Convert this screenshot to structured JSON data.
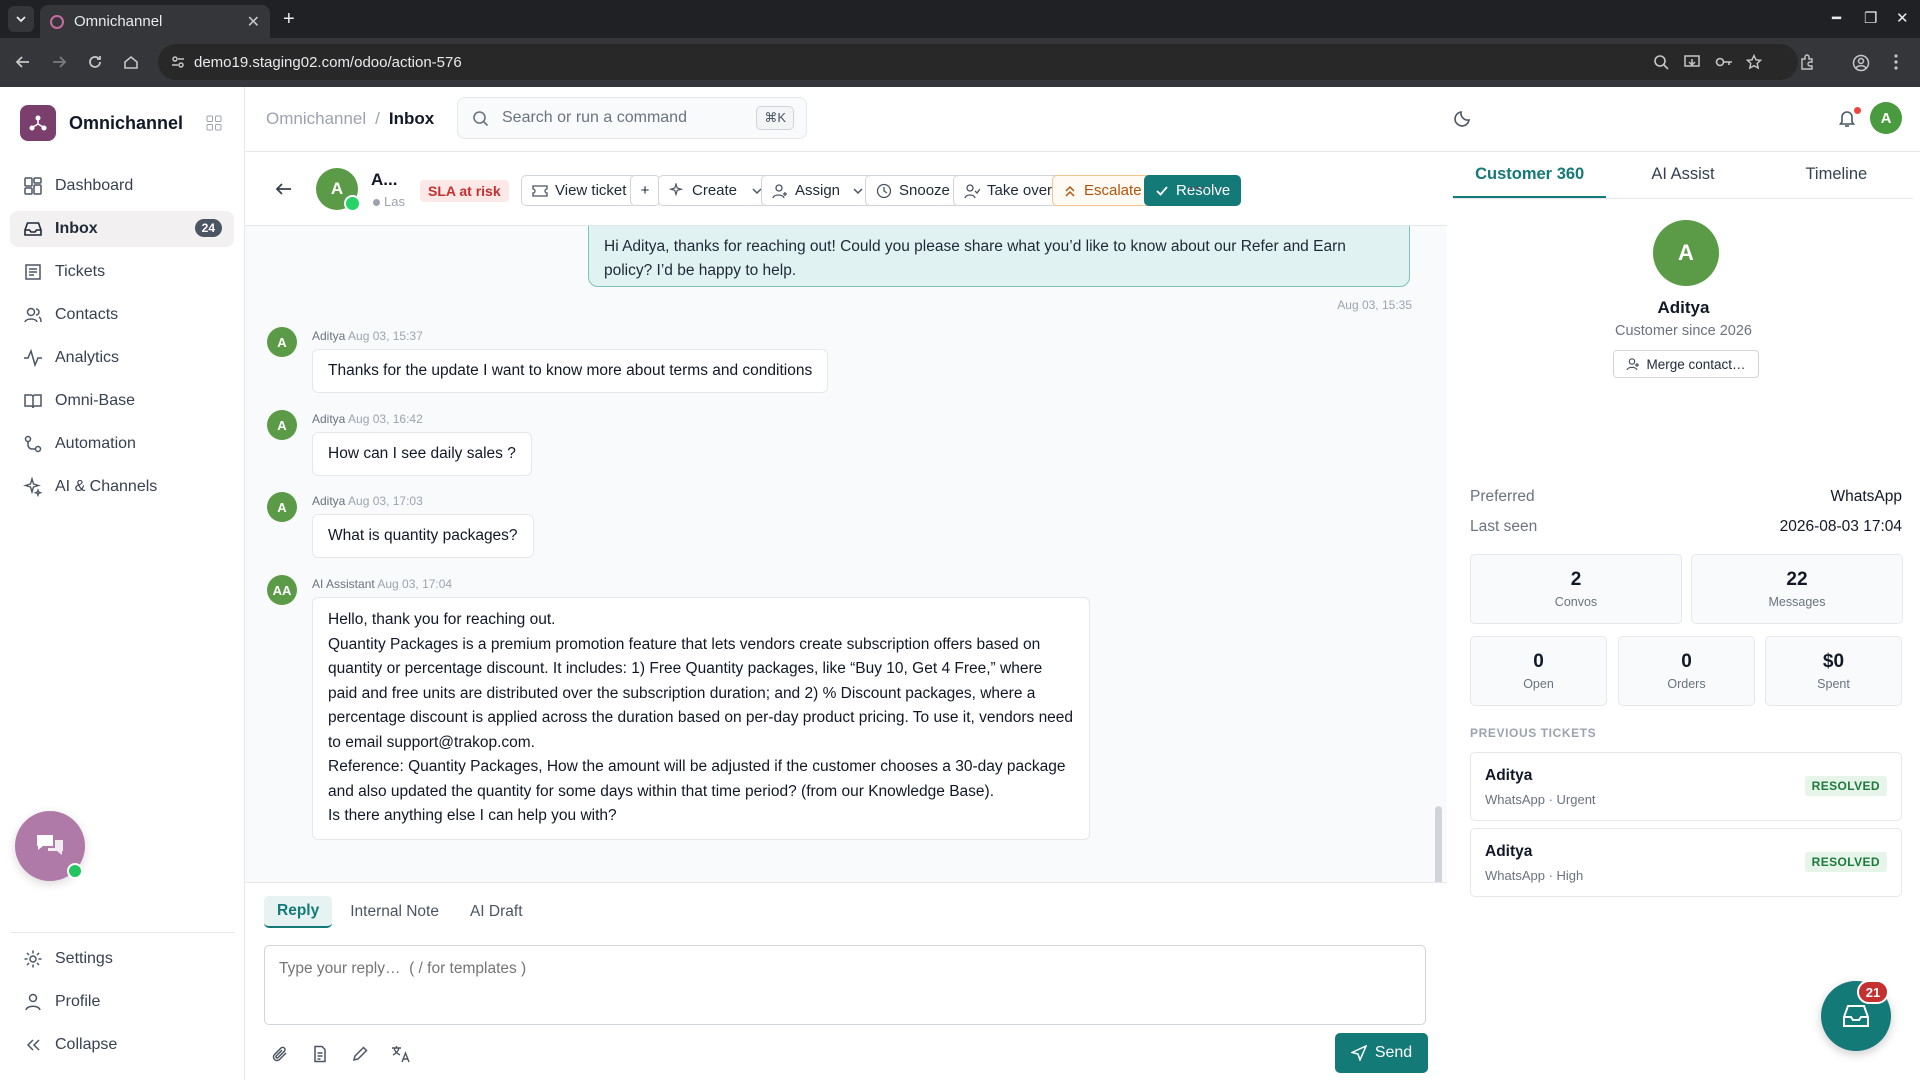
{
  "browser": {
    "tab_title": "Omnichannel",
    "url": "demo19.staging02.com/odoo/action-576"
  },
  "sidebar": {
    "brand": "Omnichannel",
    "items": [
      {
        "label": "Dashboard",
        "icon": "dashboard-icon"
      },
      {
        "label": "Inbox",
        "icon": "inbox-icon",
        "badge": "24",
        "active": true
      },
      {
        "label": "Tickets",
        "icon": "ticket-icon"
      },
      {
        "label": "Contacts",
        "icon": "contacts-icon"
      },
      {
        "label": "Analytics",
        "icon": "analytics-icon"
      },
      {
        "label": "Omni-Base",
        "icon": "book-icon"
      },
      {
        "label": "Automation",
        "icon": "automation-icon"
      },
      {
        "label": "AI & Channels",
        "icon": "sparkle-icon"
      }
    ],
    "bottom": [
      {
        "label": "Settings",
        "icon": "gear-icon"
      },
      {
        "label": "Profile",
        "icon": "user-icon"
      },
      {
        "label": "Collapse",
        "icon": "collapse-icon"
      }
    ]
  },
  "header": {
    "breadcrumb_root": "Omnichannel",
    "breadcrumb_current": "Inbox",
    "search_placeholder": "Search or run a command",
    "search_shortcut": "⌘K",
    "user_initial": "A"
  },
  "conversation": {
    "contact_initial": "A",
    "contact_name": "A...",
    "contact_sub": "Las",
    "sla_label": "SLA at risk",
    "buttons": {
      "view_ticket": "View ticket",
      "create": "Create",
      "assign": "Assign",
      "snooze": "Snooze",
      "take_over": "Take over",
      "escalate": "Escalate",
      "resolve": "Resolve"
    },
    "outgoing": {
      "text": "Hi Aditya, thanks for reaching out! Could you please share what you’d like to know about our Refer and Earn policy? I’d be happy to help.",
      "time": "Aug 03, 15:35"
    },
    "messages": [
      {
        "initials": "A",
        "author": "Aditya",
        "time": "Aug 03, 15:37",
        "text": "Thanks for the update I want to know more about terms and conditions"
      },
      {
        "initials": "A",
        "author": "Aditya",
        "time": "Aug 03, 16:42",
        "text": "How can I see daily sales ?"
      },
      {
        "initials": "A",
        "author": "Aditya",
        "time": "Aug 03, 17:03",
        "text": "What is quantity packages?"
      }
    ],
    "ai_message": {
      "initials": "AA",
      "author": "AI Assistant",
      "time": "Aug 03, 17:04",
      "line1": "Hello, thank you for reaching out.",
      "line2": "Quantity Packages is a premium promotion feature that lets vendors create subscription offers based on quantity or percentage discount. It includes: 1) Free Quantity packages, like “Buy 10, Get 4 Free,” where paid and free units are distributed over the subscription duration; and 2) % Discount packages, where a percentage discount is applied across the duration based on per-day product pricing. To use it, vendors need to email support@trakop.com.",
      "line3": "Reference: Quantity Packages, How the amount will be adjusted if the customer chooses a 30-day package and also updated the quantity for some days within that time period? (from our Knowledge Base).",
      "line4": "Is there anything else I can help you with?"
    }
  },
  "composer": {
    "tabs": [
      "Reply",
      "Internal Note",
      "AI Draft"
    ],
    "placeholder": "Type your reply…  ( / for templates )",
    "send_label": "Send"
  },
  "customer": {
    "tabs": [
      "Customer 360",
      "AI Assist",
      "Timeline"
    ],
    "initial": "A",
    "name": "Aditya",
    "since": "Customer since 2026",
    "merge_label": "Merge contact…",
    "preferred_label": "Preferred",
    "preferred_value": "WhatsApp",
    "last_seen_label": "Last seen",
    "last_seen_value": "2026-08-03 17:04",
    "stats": [
      {
        "value": "2",
        "label": "Convos"
      },
      {
        "value": "22",
        "label": "Messages"
      },
      {
        "value": "0",
        "label": "Open"
      },
      {
        "value": "0",
        "label": "Orders"
      },
      {
        "value": "$0",
        "label": "Spent"
      }
    ],
    "previous_title": "PREVIOUS TICKETS",
    "tickets": [
      {
        "name": "Aditya",
        "sub": "WhatsApp · Urgent",
        "status": "RESOLVED"
      },
      {
        "name": "Aditya",
        "sub": "WhatsApp · High",
        "status": "RESOLVED"
      }
    ]
  },
  "inbox_fab_count": "21",
  "colors": {
    "brand": "#7b3f6e",
    "accent": "#147a78",
    "avatar": "#5b9a46",
    "danger": "#c53030"
  }
}
